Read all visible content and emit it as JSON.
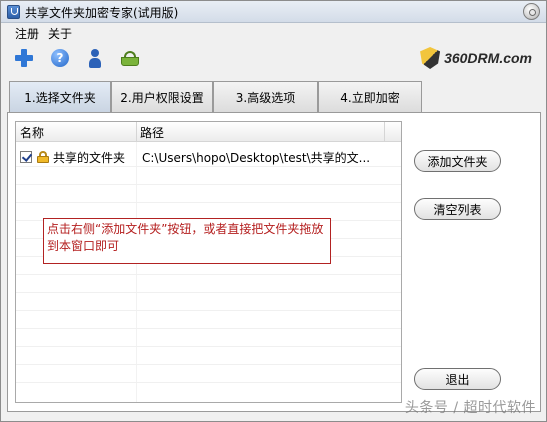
{
  "window": {
    "title": "共享文件夹加密专家(试用版)"
  },
  "menu": {
    "items": [
      "注册",
      "关于"
    ]
  },
  "toolbar": {
    "icons": [
      "plus-icon",
      "help-icon",
      "user-icon",
      "basket-icon"
    ],
    "help_glyph": "?"
  },
  "brand": {
    "text": "360DRM.com"
  },
  "tabs": [
    {
      "label": "1.选择文件夹",
      "active": true
    },
    {
      "label": "2.用户权限设置",
      "active": false
    },
    {
      "label": "3.高级选项",
      "active": false
    },
    {
      "label": "4.立即加密",
      "active": false
    }
  ],
  "list": {
    "columns": [
      "名称",
      "路径"
    ],
    "rows": [
      {
        "checked": true,
        "name": "共享的文件夹",
        "path": "C:\\Users\\hopo\\Desktop\\test\\共享的文..."
      }
    ]
  },
  "hint": "点击右侧“添加文件夹”按钮，或者直接把文件夹拖放到本窗口即可",
  "buttons": {
    "add": "添加文件夹",
    "clear": "清空列表",
    "exit": "退出"
  },
  "watermark": "头条号 / 超时代软件",
  "colors": {
    "hint_text": "#b41e1e",
    "hint_border": "#b22222",
    "accent_blue": "#2f77d6"
  }
}
